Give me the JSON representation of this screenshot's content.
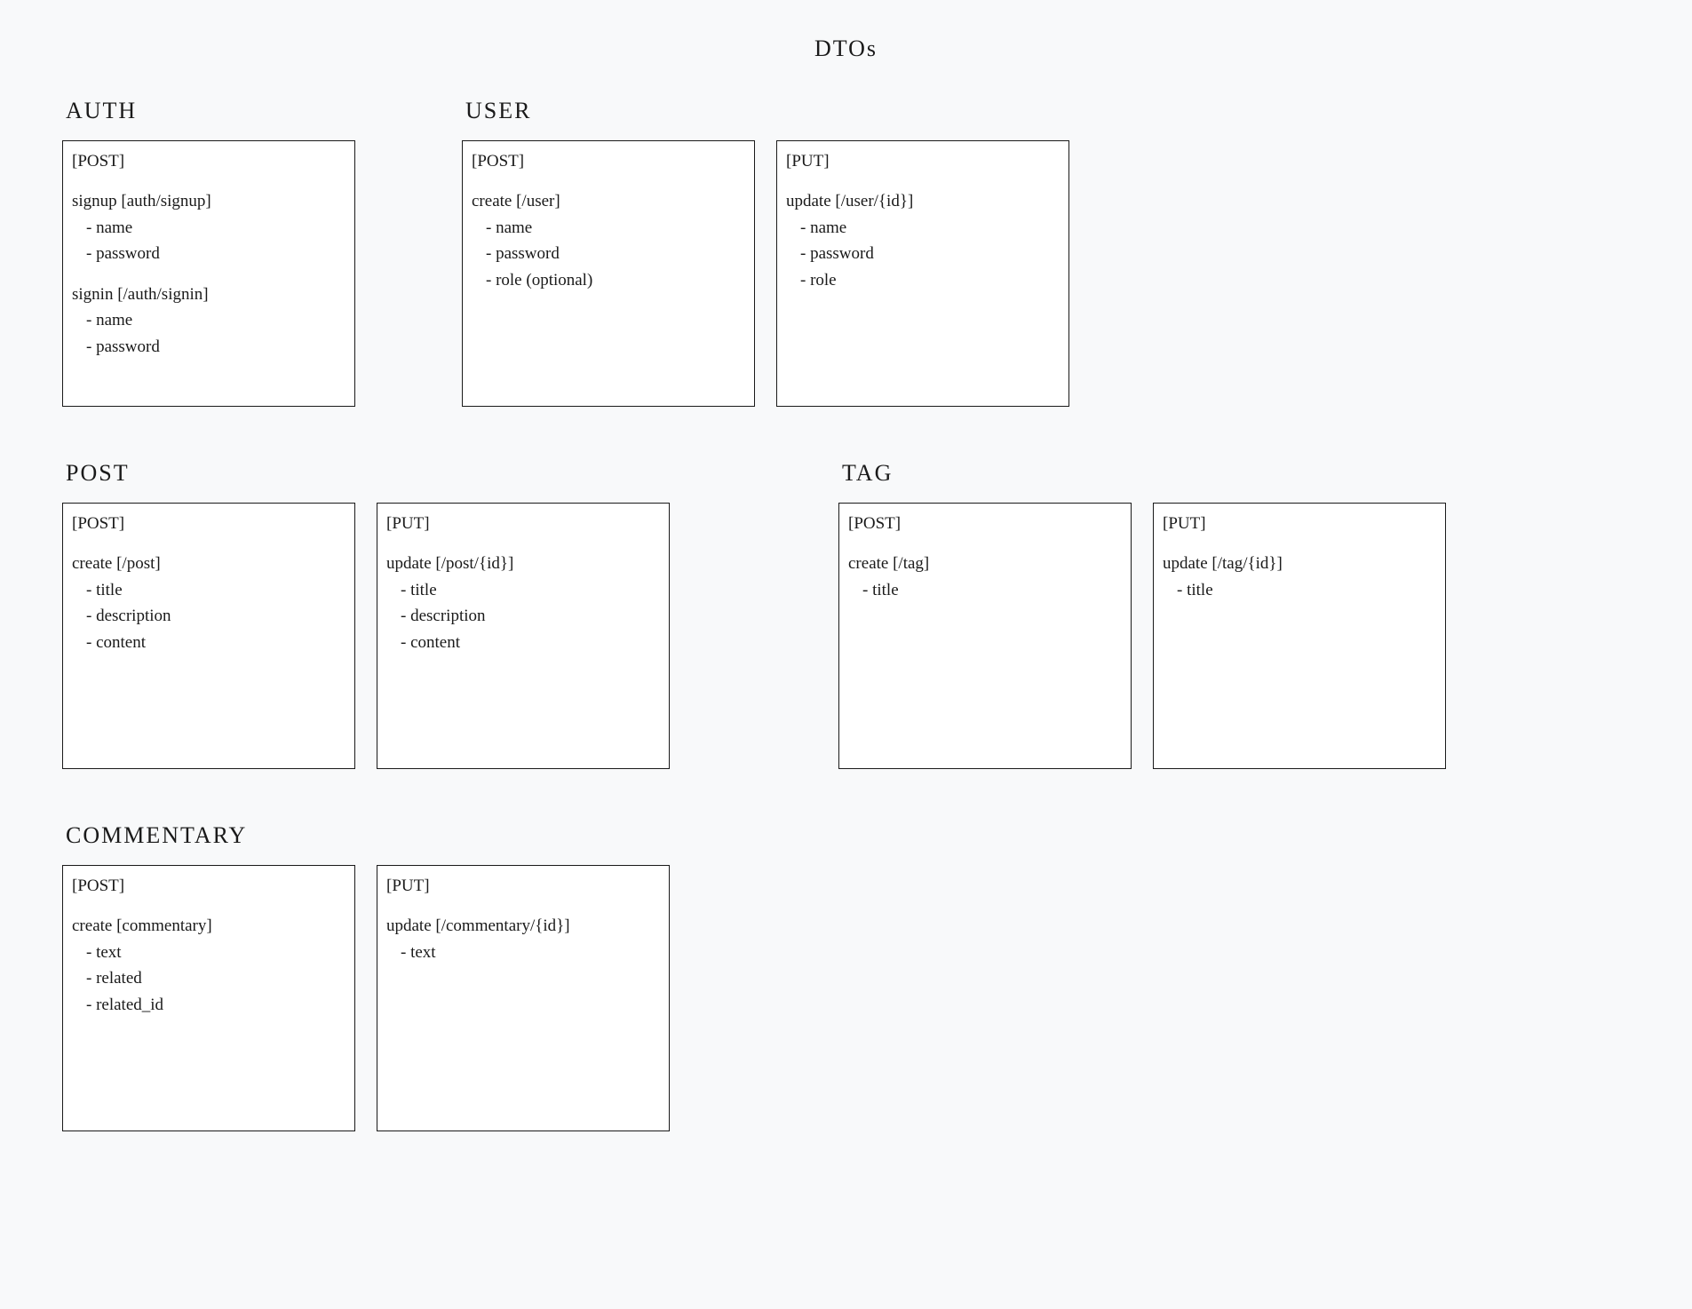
{
  "title": "DTOs",
  "sections": {
    "auth": {
      "title": "AUTH",
      "cards": [
        {
          "method": "[POST]",
          "ops": [
            {
              "title": "signup [auth/signup]",
              "fields": [
                "- name",
                "- password"
              ]
            },
            {
              "title": "signin [/auth/signin]",
              "fields": [
                "- name",
                "- password"
              ]
            }
          ]
        }
      ]
    },
    "user": {
      "title": "USER",
      "cards": [
        {
          "method": "[POST]",
          "ops": [
            {
              "title": "create [/user]",
              "fields": [
                "- name",
                "- password",
                "- role (optional)"
              ]
            }
          ]
        },
        {
          "method": "[PUT]",
          "ops": [
            {
              "title": "update [/user/{id}]",
              "fields": [
                "- name",
                "- password",
                "- role"
              ]
            }
          ]
        }
      ]
    },
    "post": {
      "title": "POST",
      "cards": [
        {
          "method": "[POST]",
          "ops": [
            {
              "title": "create [/post]",
              "fields": [
                "- title",
                "- description",
                "- content"
              ]
            }
          ]
        },
        {
          "method": "[PUT]",
          "ops": [
            {
              "title": "update [/post/{id}]",
              "fields": [
                "- title",
                "- description",
                "- content"
              ]
            }
          ]
        }
      ]
    },
    "tag": {
      "title": "TAG",
      "cards": [
        {
          "method": "[POST]",
          "ops": [
            {
              "title": "create [/tag]",
              "fields": [
                "- title"
              ]
            }
          ]
        },
        {
          "method": "[PUT]",
          "ops": [
            {
              "title": "update [/tag/{id}]",
              "fields": [
                "- title"
              ]
            }
          ]
        }
      ]
    },
    "commentary": {
      "title": "COMMENTARY",
      "cards": [
        {
          "method": "[POST]",
          "ops": [
            {
              "title": "create [commentary]",
              "fields": [
                "- text",
                "- related",
                "- related_id"
              ]
            }
          ]
        },
        {
          "method": "[PUT]",
          "ops": [
            {
              "title": "update [/commentary/{id}]",
              "fields": [
                "- text"
              ]
            }
          ]
        }
      ]
    }
  }
}
